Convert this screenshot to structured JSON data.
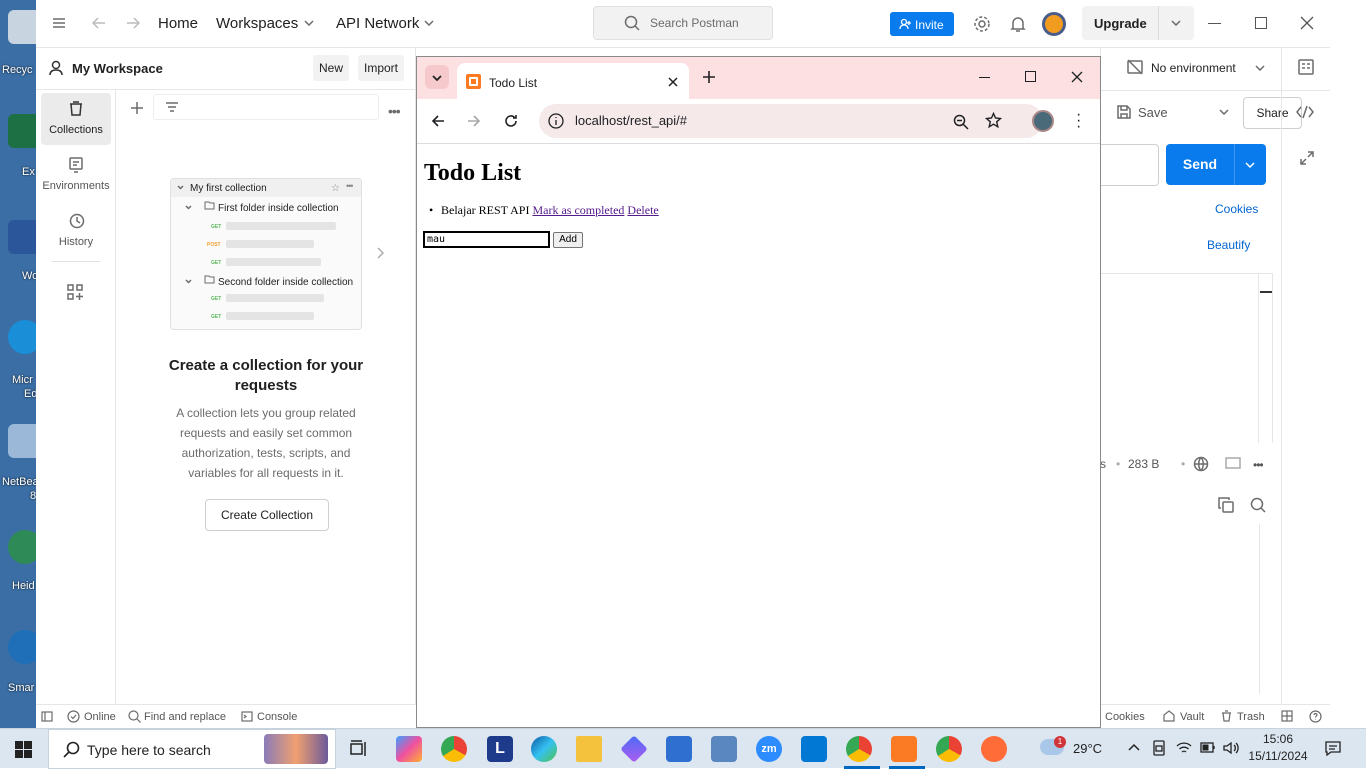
{
  "desktop": {
    "icons": [
      {
        "label": "Recyc"
      },
      {
        "label": "Ex"
      },
      {
        "label": "Wo"
      },
      {
        "label": "Micr",
        "label2": "Ed"
      },
      {
        "label": "NetBea",
        "label2": "8"
      },
      {
        "label": "Heid"
      },
      {
        "label": "Smar"
      }
    ]
  },
  "postman": {
    "nav": {
      "home": "Home",
      "workspaces": "Workspaces",
      "api_network": "API Network"
    },
    "search_placeholder": "Search Postman",
    "invite": "Invite",
    "upgrade": "Upgrade",
    "workspace_name": "My Workspace",
    "new_btn": "New",
    "import_btn": "Import",
    "rail": [
      "Collections",
      "Environments",
      "History"
    ],
    "card": {
      "collection": "My first collection",
      "folder1": "First folder inside collection",
      "folder2": "Second folder inside collection",
      "methods": [
        "GET",
        "POST",
        "GET",
        "GET",
        "GET"
      ]
    },
    "empty_title": "Create a collection for your requests",
    "empty_desc": "A collection lets you group related requests and easily set common authorization, tests, scripts, and variables for all requests in it.",
    "create_btn": "Create Collection",
    "environment": "No environment",
    "save": "Save",
    "share": "Share",
    "send": "Send",
    "cookies": "Cookies",
    "beautify": "Beautify",
    "resp_partial": "s",
    "resp_size": "283 B",
    "footer": {
      "online": "Online",
      "find_replace": "Find and replace",
      "console": "Console",
      "cookies": "Cookies",
      "vault": "Vault",
      "trash": "Trash"
    }
  },
  "chrome": {
    "tab_title": "Todo List",
    "url": "localhost/rest_api/#",
    "page": {
      "heading": "Todo List",
      "items": [
        {
          "text": "Belajar REST API",
          "complete_link": "Mark as completed",
          "delete_link": "Delete"
        }
      ],
      "input_value": "mau",
      "add_button": "Add"
    }
  },
  "taskbar": {
    "search_placeholder": "Type here to search",
    "weather": "29°C",
    "weather_badge": "1",
    "time": "15:06",
    "date": "15/11/2024"
  },
  "colors": {
    "postman_blue": "#097bed",
    "chrome_tab_strip": "#fde0e2",
    "link_visited": "#551a8b"
  }
}
